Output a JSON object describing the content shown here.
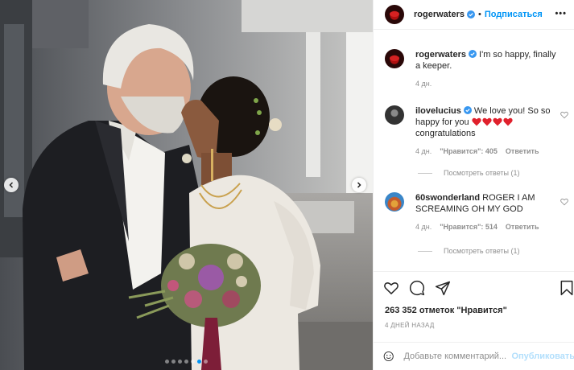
{
  "post": {
    "author": "rogerwaters",
    "separator": "•",
    "follow_label": "Подписаться",
    "more_label": "•••",
    "verified_color": "#3897f0",
    "accent": "#0095f6"
  },
  "caption": {
    "username": "rogerwaters",
    "text": "I'm so happy, finally a keeper.",
    "time": "4 дн."
  },
  "comments": [
    {
      "username": "ilovelucius",
      "text": "We love you! So so happy for you",
      "hearts": [
        "❤",
        "❤",
        "❤",
        "❤"
      ],
      "text_after": "congratulations",
      "time": "4 дн.",
      "likes": "\"Нравится\": 405",
      "reply_label": "Ответить",
      "view_replies": "Посмотреть ответы (1)"
    },
    {
      "username": "60swonderland",
      "text": "ROGER I AM SCREAMING OH MY GOD",
      "time": "4 дн.",
      "likes": "\"Нравится\": 514",
      "reply_label": "Ответить",
      "view_replies": "Посмотреть ответы (1)"
    }
  ],
  "actions": {
    "icons": [
      "heart-icon",
      "comment-icon",
      "share-icon",
      "bookmark-icon"
    ]
  },
  "likes_label": "263 352 отметок \"Нравится\"",
  "posted_ago": "4 ДНЕЙ НАЗАД",
  "composer": {
    "placeholder": "Добавьте комментарий...",
    "publish_label": "Опубликовать",
    "publish_color": "#b2dffc"
  },
  "carousel": {
    "slide_count": 7,
    "active_index": 5
  }
}
